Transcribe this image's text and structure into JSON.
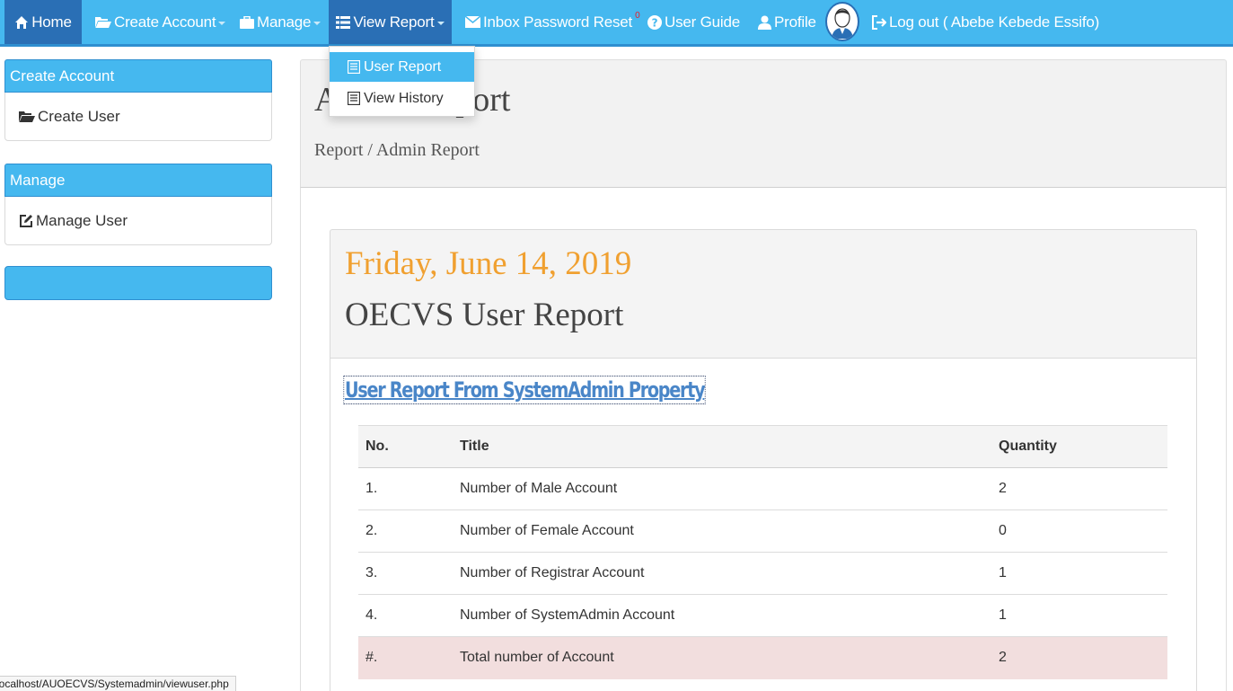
{
  "nav": {
    "home": "Home",
    "create_account": "Create Account",
    "manage": "Manage",
    "view_report": "View Report",
    "inbox_password_reset": "Inbox Password Reset",
    "inbox_badge": "0",
    "user_guide": "User Guide",
    "profile": "Profile",
    "logout": "Log out ( Abebe Kebede Essifo)"
  },
  "dropdown": {
    "items": [
      {
        "label": "User Report",
        "active": true
      },
      {
        "label": "View History",
        "active": false
      }
    ]
  },
  "sidebar": {
    "panels": [
      {
        "title": "Create Account",
        "item": "Create User"
      },
      {
        "title": "Manage",
        "item": "Manage User"
      }
    ]
  },
  "header": {
    "title": "Admin Report",
    "breadcrumb": "Report / Admin Report"
  },
  "report": {
    "date": "Friday, June 14, 2019",
    "title": "OECVS User Report",
    "link": "User Report From SystemAdmin Property",
    "columns": [
      "No.",
      "Title",
      "Quantity"
    ],
    "rows": [
      {
        "no": "1.",
        "title": "Number of Male Account",
        "qty": "2"
      },
      {
        "no": "2.",
        "title": "Number of Female Account",
        "qty": "0"
      },
      {
        "no": "3.",
        "title": "Number of Registrar Account",
        "qty": "1"
      },
      {
        "no": "4.",
        "title": "Number of SystemAdmin Account",
        "qty": "1"
      },
      {
        "no": "#.",
        "title": "Total number of Account",
        "qty": "2"
      }
    ]
  },
  "status_url": "localhost/AUOECVS/Systemadmin/viewuser.php",
  "icons": {
    "home": "home-icon",
    "create_account": "folder-open-icon",
    "manage": "briefcase-icon",
    "view_report": "list-icon",
    "inbox": "envelope-icon",
    "user_guide": "question-circle-icon",
    "profile": "user-icon",
    "logout": "logout-icon",
    "dropdown_item": "document-icon",
    "manage_user": "edit-icon"
  },
  "colors": {
    "nav_bg": "#45b8ef",
    "nav_active": "#2a6fb5",
    "date_orange": "#f0a030",
    "link_blue": "#4a86c8",
    "total_row": "#f2dede"
  }
}
